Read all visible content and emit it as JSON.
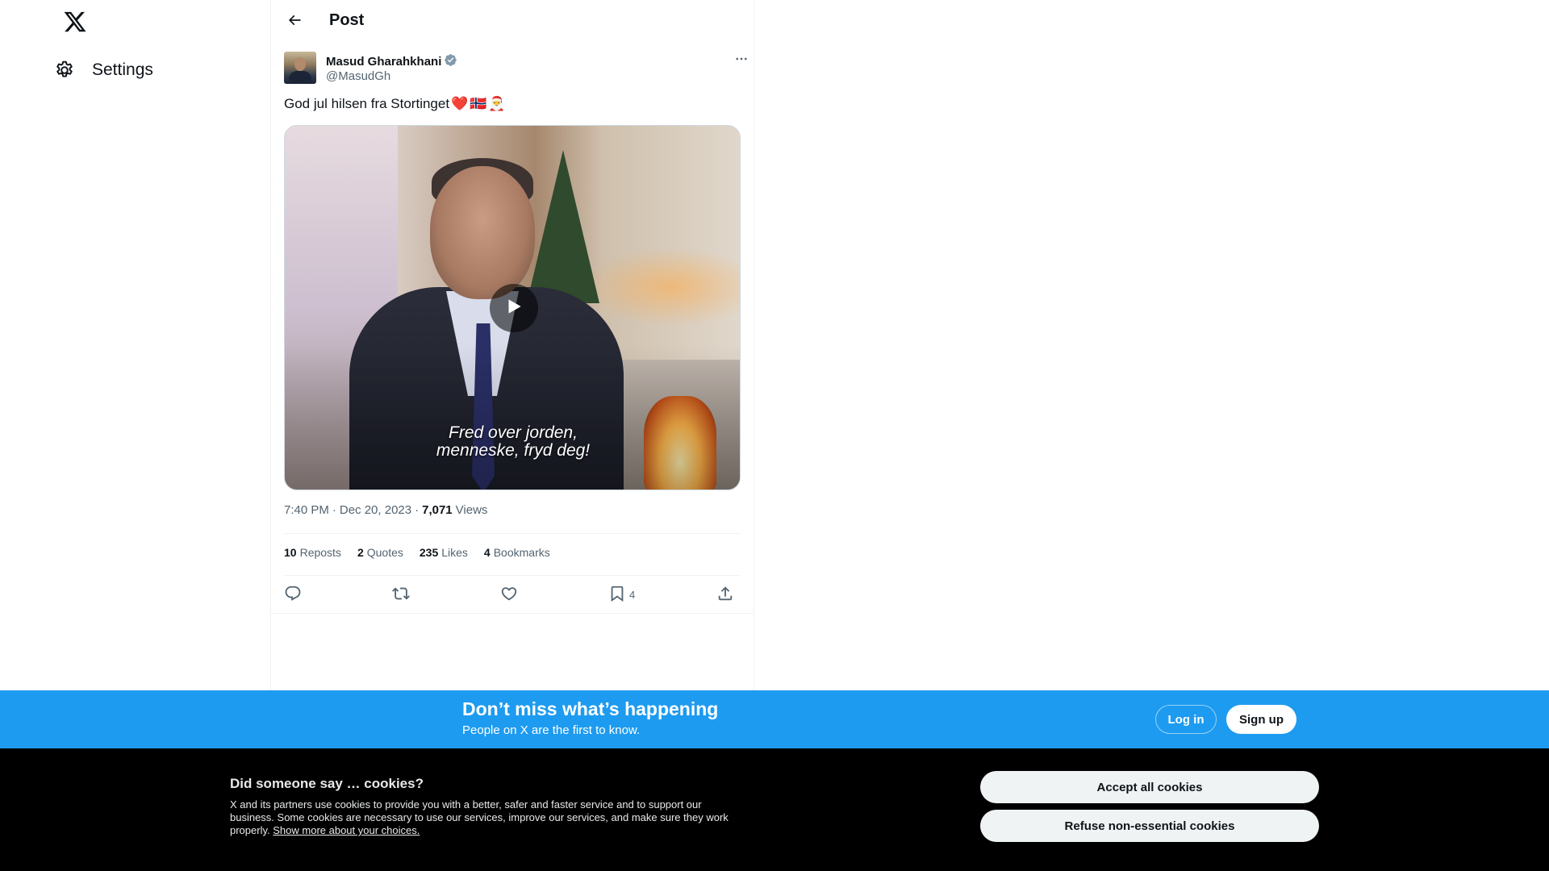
{
  "nav": {
    "logo_icon": "x-logo-icon",
    "settings_label": "Settings",
    "settings_icon": "gear-icon"
  },
  "header": {
    "title": "Post",
    "back_icon": "arrow-left-icon"
  },
  "post": {
    "author_name": "Masud Gharahkhani",
    "author_handle": "@MasudGh",
    "verified_icon": "verified-badge-icon",
    "more_icon": "more-dots-icon",
    "text": "God jul hilsen fra Stortinget",
    "text_emojis": [
      "❤️",
      "🇳🇴",
      "🎅"
    ],
    "media": {
      "type": "video",
      "caption_line1": "Fred over jorden,",
      "caption_line2": "menneske, fryd deg!",
      "play_icon": "play-icon"
    },
    "time": "7:40 PM",
    "date": "Dec 20, 2023",
    "views_count": "7,071",
    "views_label": "Views",
    "stats": {
      "reposts_count": "10",
      "reposts_label": "Reposts",
      "quotes_count": "2",
      "quotes_label": "Quotes",
      "likes_count": "235",
      "likes_label": "Likes",
      "bookmarks_count": "4",
      "bookmarks_label": "Bookmarks"
    },
    "actions": {
      "reply_icon": "reply-icon",
      "repost_icon": "repost-icon",
      "like_icon": "heart-icon",
      "bookmark_icon": "bookmark-icon",
      "bookmark_count": "4",
      "share_icon": "share-icon"
    }
  },
  "banner": {
    "headline": "Don’t miss what’s happening",
    "subtext": "People on X are the first to know.",
    "login_label": "Log in",
    "signup_label": "Sign up",
    "color": "#1d9bf0"
  },
  "cookie": {
    "title": "Did someone say … cookies?",
    "body": "X and its partners use cookies to provide you with a better, safer and faster service and to support our business. Some cookies are necessary to use our services, improve our services, and make sure they work properly.",
    "link": "Show more about your choices.",
    "accept_label": "Accept all cookies",
    "refuse_label": "Refuse non-essential cookies"
  }
}
